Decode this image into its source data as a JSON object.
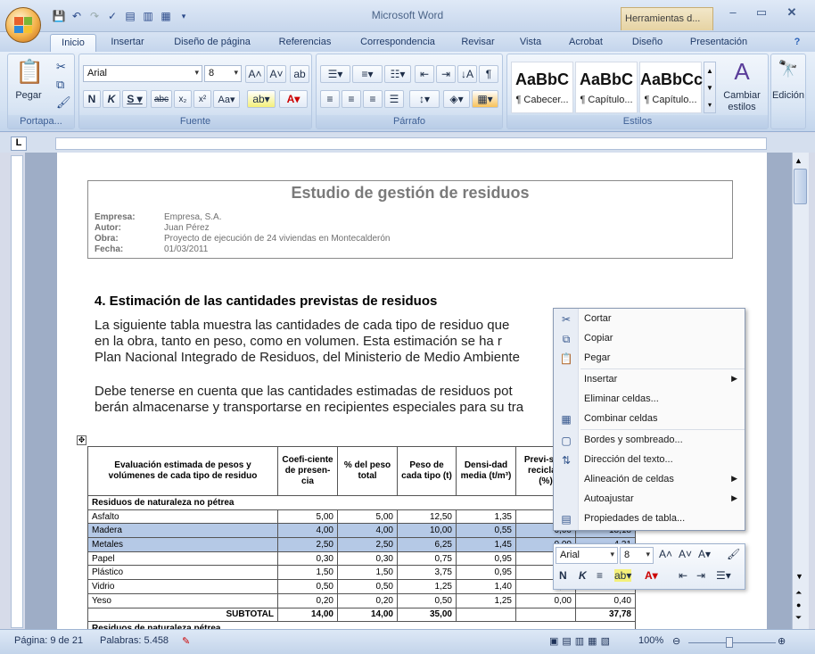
{
  "window": {
    "app_title": "Microsoft Word",
    "context_tab": "Herramientas d..."
  },
  "tabs": [
    "Inicio",
    "Insertar",
    "Diseño de página",
    "Referencias",
    "Correspondencia",
    "Revisar",
    "Vista",
    "Acrobat",
    "Diseño",
    "Presentación"
  ],
  "ribbon": {
    "paste_label": "Pegar",
    "font_name": "Arial",
    "font_size": "8",
    "group_portapapeles": "Portapa...",
    "group_fuente": "Fuente",
    "group_parrafo": "Párrafo",
    "group_estilos": "Estilos",
    "styles": [
      {
        "preview": "AaBbC",
        "name": "¶ Cabecer..."
      },
      {
        "preview": "AaBbC",
        "name": "¶ Capítulo..."
      },
      {
        "preview": "AaBbCc",
        "name": "¶ Capítulo..."
      }
    ],
    "change_styles": "Cambiar estilos",
    "edicion": "Edición"
  },
  "document": {
    "title": "Estudio de gestión de residuos",
    "meta": [
      {
        "label": "Empresa:",
        "value": "Empresa, S.A."
      },
      {
        "label": "Autor:",
        "value": "Juan Pérez"
      },
      {
        "label": "Obra:",
        "value": "Proyecto de ejecución de 24 viviendas en Montecalderón"
      },
      {
        "label": "Fecha:",
        "value": "01/03/2011"
      }
    ],
    "heading": "4. Estimación de las cantidades previstas de residuos",
    "para1": [
      "La siguiente tabla muestra las cantidades de cada tipo de residuo que",
      "en la obra, tanto en peso, como en volumen. Esta estimación se ha r",
      "Plan Nacional Integrado de Residuos, del Ministerio de Medio Ambiente"
    ],
    "para2": [
      "Debe tenerse en cuenta que las cantidades estimadas de residuos pot",
      "berán almacenarse y transportarse en recipientes especiales para su tra"
    ]
  },
  "table": {
    "headers": [
      "Evaluación estimada de pesos y volúmenes de cada tipo de residuo",
      "Coefi-ciente de presen-cia",
      "% del peso total",
      "Peso de cada tipo (t)",
      "Densi-dad media (t/m³)",
      "Previ-sión reciclaje (%)",
      ""
    ],
    "section1": "Residuos de naturaleza no pétrea",
    "rows": [
      {
        "name": "Asfalto",
        "c": [
          "5,00",
          "5,00",
          "12,50",
          "1,35",
          "0,00",
          ""
        ],
        "sel": false
      },
      {
        "name": "Madera",
        "c": [
          "4,00",
          "4,00",
          "10,00",
          "0,55",
          "0,00",
          "18,18"
        ],
        "sel": true
      },
      {
        "name": "Metales",
        "c": [
          "2,50",
          "2,50",
          "6,25",
          "1,45",
          "0,00",
          "4,31"
        ],
        "sel": true
      },
      {
        "name": "Papel",
        "c": [
          "0,30",
          "0,30",
          "0,75",
          "0,95",
          "0,00",
          ""
        ],
        "sel": false
      },
      {
        "name": "Plástico",
        "c": [
          "1,50",
          "1,50",
          "3,75",
          "0,95",
          "0,00",
          ""
        ],
        "sel": false
      },
      {
        "name": "Vidrio",
        "c": [
          "0,50",
          "0,50",
          "1,25",
          "1,40",
          "0,00",
          ""
        ],
        "sel": false
      },
      {
        "name": "Yeso",
        "c": [
          "0,20",
          "0,20",
          "0,50",
          "1,25",
          "0,00",
          "0,40"
        ],
        "sel": false
      }
    ],
    "subtotal": {
      "label": "SUBTOTAL",
      "c": [
        "14,00",
        "14,00",
        "35,00",
        "",
        "",
        "37,78"
      ]
    },
    "section2": "Residuos de naturaleza pétrea"
  },
  "context_menu": [
    {
      "label": "Cortar",
      "icon": "scissors-icon",
      "sub": false
    },
    {
      "label": "Copiar",
      "icon": "copy-icon",
      "sub": false
    },
    {
      "label": "Pegar",
      "icon": "paste-icon",
      "sub": false
    },
    {
      "label": "Insertar",
      "icon": "",
      "sub": true
    },
    {
      "label": "Eliminar celdas...",
      "icon": "",
      "sub": false
    },
    {
      "label": "Combinar celdas",
      "icon": "merge-cells-icon",
      "sub": false
    },
    {
      "label": "Bordes y sombreado...",
      "icon": "borders-icon",
      "sub": false
    },
    {
      "label": "Dirección del texto...",
      "icon": "text-direction-icon",
      "sub": false
    },
    {
      "label": "Alineación de celdas",
      "icon": "",
      "sub": true
    },
    {
      "label": "Autoajustar",
      "icon": "",
      "sub": true
    },
    {
      "label": "Propiedades de tabla...",
      "icon": "table-properties-icon",
      "sub": false
    }
  ],
  "mini_toolbar": {
    "font_name": "Arial",
    "font_size": "8"
  },
  "status": {
    "page": "Página: 9 de 21",
    "words": "Palabras: 5.458",
    "zoom": "100%"
  },
  "colors": {
    "accent": "#1f3a68",
    "selection": "#b5c9e6",
    "ribbon": "#d3e1f2"
  }
}
